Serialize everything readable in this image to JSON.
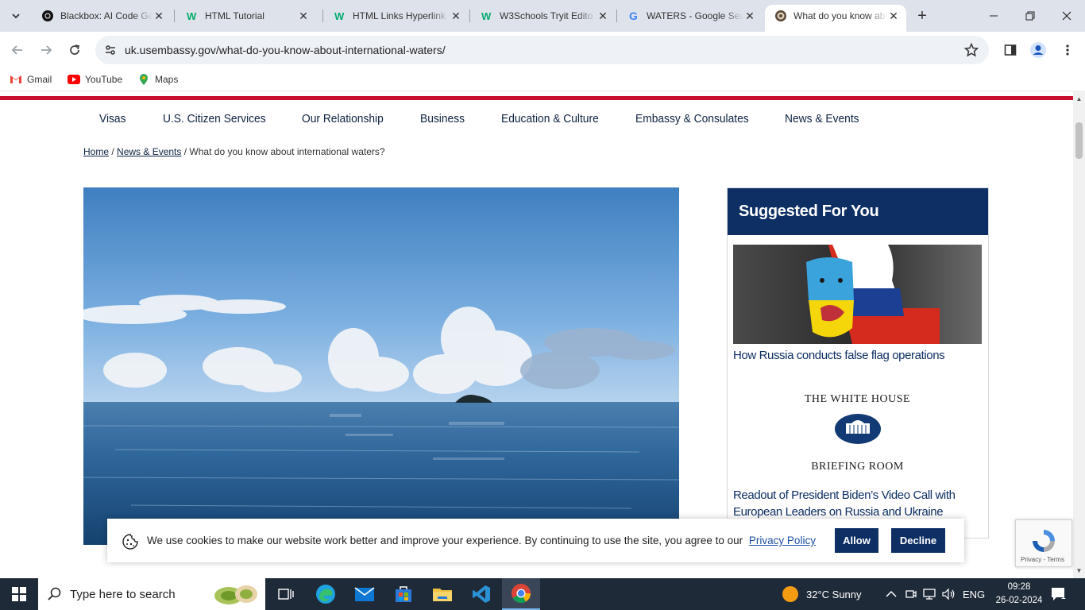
{
  "browser": {
    "tabs": [
      {
        "title": "Blackbox: AI Code Ge",
        "icon": "blackbox-icon"
      },
      {
        "title": "HTML Tutorial",
        "icon": "w3schools-icon"
      },
      {
        "title": "HTML Links Hyperlink",
        "icon": "w3schools-icon"
      },
      {
        "title": "W3Schools Tryit Edito",
        "icon": "w3schools-icon"
      },
      {
        "title": "WATERS - Google Sea",
        "icon": "google-icon"
      },
      {
        "title": "What do you know ab",
        "icon": "embassy-seal-icon",
        "active": true
      }
    ],
    "url": "uk.usembassy.gov/what-do-you-know-about-international-waters/",
    "bookmarks": [
      {
        "label": "Gmail",
        "icon": "gmail-icon"
      },
      {
        "label": "YouTube",
        "icon": "youtube-icon"
      },
      {
        "label": "Maps",
        "icon": "maps-icon"
      }
    ]
  },
  "page": {
    "nav": [
      "Visas",
      "U.S. Citizen Services",
      "Our Relationship",
      "Business",
      "Education & Culture",
      "Embassy & Consulates",
      "News & Events"
    ],
    "breadcrumb": {
      "home": "Home",
      "sep": " / ",
      "section": "News & Events",
      "current": "What do you know about international waters?"
    },
    "sidebar": {
      "heading": "Suggested For You",
      "items": [
        {
          "title": "How Russia conducts false flag operations"
        },
        {
          "title": "Readout of President Biden’s Video Call with European Leaders on Russia and Ukraine"
        }
      ],
      "white_house": {
        "line1": "THE WHITE HOUSE",
        "line2": "BRIEFING ROOM"
      }
    },
    "cookie": {
      "message": "We use cookies to make our website work better and improve your experience. By continuing to use the site, you agree to our",
      "link": "Privacy Policy",
      "allow": "Allow",
      "decline": "Decline"
    },
    "recaptcha": {
      "text": "Privacy - Terms"
    },
    "colors": {
      "accent_red": "#c8102e",
      "navy": "#0d2f64"
    }
  },
  "taskbar": {
    "search_placeholder": "Type here to search",
    "weather": "32°C  Sunny",
    "lang": "ENG",
    "time": "09:28",
    "date": "26-02-2024",
    "notifications": "1"
  }
}
